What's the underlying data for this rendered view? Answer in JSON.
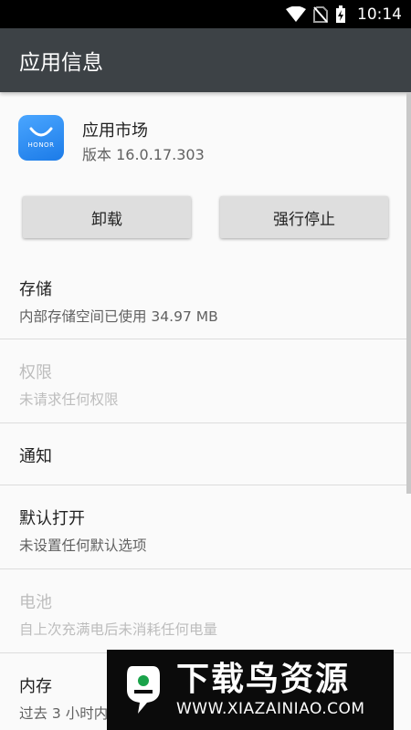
{
  "status_bar": {
    "time": "10:14",
    "icons": [
      "wifi-icon",
      "no-sim-icon",
      "battery-charging-icon"
    ]
  },
  "app_bar": {
    "title": "应用信息"
  },
  "app": {
    "name": "应用市场",
    "version": "版本 16.0.17.303",
    "icon_brand": "HONOR"
  },
  "buttons": {
    "uninstall": "卸载",
    "force_stop": "强行停止"
  },
  "items": [
    {
      "title": "存储",
      "subtitle": "内部存储空间已使用 34.97 MB",
      "disabled": false
    },
    {
      "title": "权限",
      "subtitle": "未请求任何权限",
      "disabled": true
    },
    {
      "title": "通知",
      "subtitle": "",
      "disabled": false
    },
    {
      "title": "默认打开",
      "subtitle": "未设置任何默认选项",
      "disabled": false
    },
    {
      "title": "电池",
      "subtitle": "自上次充满电后未消耗任何电量",
      "disabled": true
    },
    {
      "title": "内存",
      "subtitle": "过去 3 小时内",
      "disabled": false
    }
  ],
  "watermark": {
    "title": "下载鸟资源",
    "url": "WWW.XIAZAINIAO.COM"
  },
  "colors": {
    "app_bar": "#3d4246",
    "background": "#fafafa",
    "button": "#dedede",
    "icon": "#1c7be8"
  }
}
